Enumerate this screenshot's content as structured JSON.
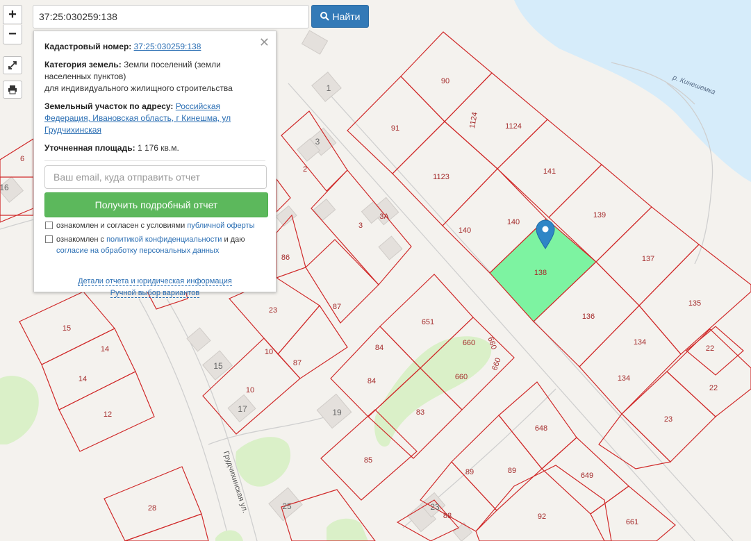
{
  "search": {
    "value": "37:25:030259:138",
    "button_label": "Найти"
  },
  "controls": {
    "zoom_in": "+",
    "zoom_out": "−"
  },
  "popup": {
    "close": "✕",
    "cadastral_label": "Кадастровый номер:",
    "cadastral_value": "37:25:030259:138",
    "category_label": "Категория земель:",
    "category_value": "Земли поселений (земли населенных пунктов)",
    "category_use": "для индивидуального жилищного строительства",
    "address_label": "Земельный участок по адресу:",
    "address_value": "Российская Федерация, Ивановская область, г Кинешма, ул Грудчихинская",
    "area_label": "Уточненная площадь:",
    "area_value": "1 176 кв.м.",
    "email_placeholder": "Ваш email, куда отправить отчет",
    "report_button": "Получить подробный отчет",
    "check1_text": "ознакомлен и согласен с условиями ",
    "check1_link": "публичной оферты",
    "check2_text_a": "ознакомлен с ",
    "check2_link_a": "политикой конфиденциальности",
    "check2_text_b": " и даю ",
    "check2_link_b": "согласие на обработку персональных данных",
    "link_details": "Детали отчета и юридическая информация",
    "link_manual": "Ручной выбор вариантов"
  },
  "map": {
    "river_label": "р. Кинешемка",
    "street_label": "Грудчихинская ул.",
    "parcel_numbers": [
      "90",
      "91",
      "1124",
      "1124",
      "1123",
      "141",
      "140",
      "140",
      "139",
      "138",
      "137",
      "136",
      "135",
      "134",
      "134",
      "22",
      "22",
      "23",
      "651",
      "660",
      "660",
      "660",
      "660",
      "84",
      "84",
      "83",
      "85",
      "648",
      "649",
      "89",
      "89",
      "88",
      "92",
      "661",
      "86",
      "87",
      "87",
      "23",
      "10",
      "10",
      "3",
      "3А",
      "2",
      "1",
      "15",
      "14",
      "14",
      "12",
      "6",
      "16",
      "28",
      "19",
      "17",
      "15",
      "25",
      "23"
    ],
    "colors": {
      "parcel_border": "#d02a2a",
      "selected_fill": "#7df3a1",
      "water": "#d6ecfa",
      "greenery": "#daf0c8",
      "marker": "#2f86c6"
    }
  }
}
